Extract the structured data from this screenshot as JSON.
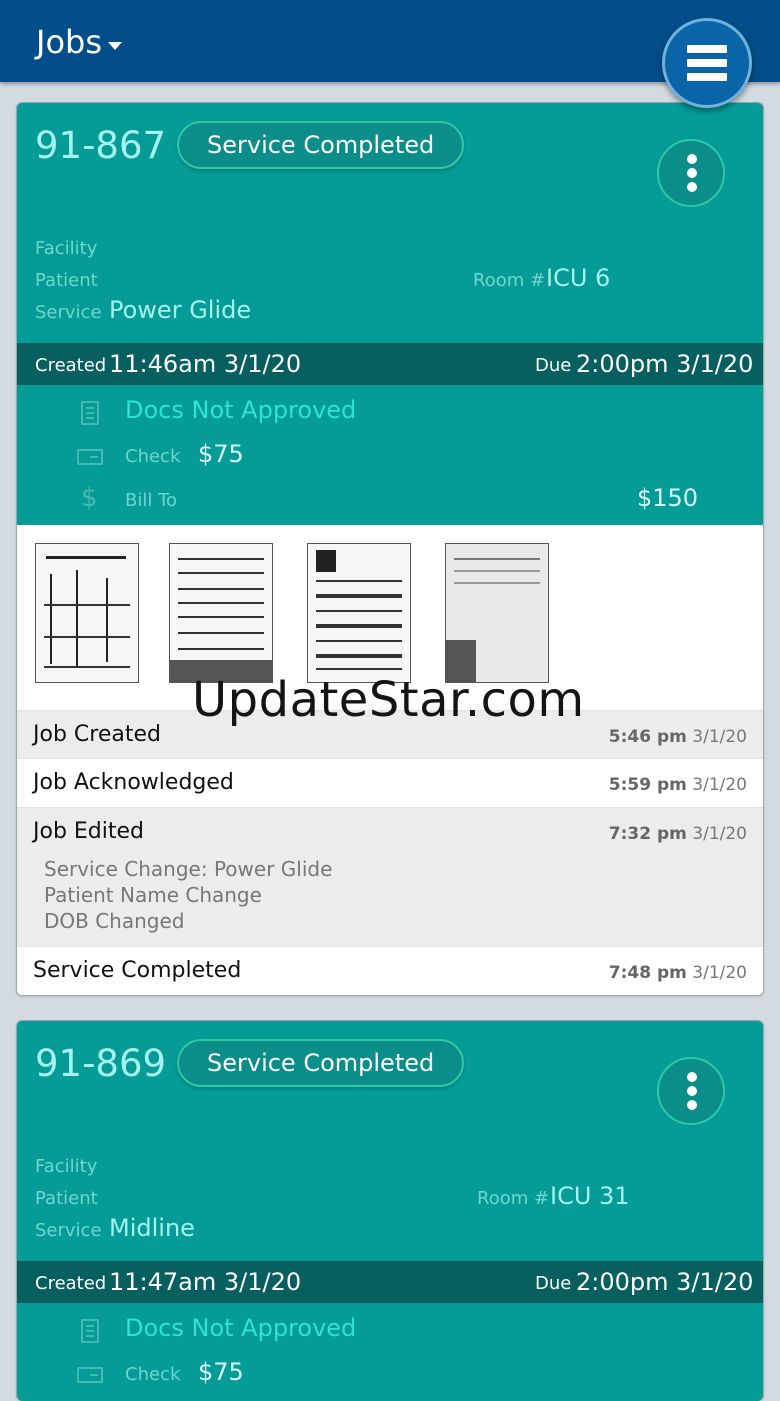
{
  "header": {
    "title": "Jobs"
  },
  "jobs": [
    {
      "id": "91-867",
      "status": "Service Completed",
      "facility_label": "Facility",
      "patient_label": "Patient",
      "service_label": "Service",
      "service_value": "Power Glide",
      "room_label": "Room #",
      "room_value": "ICU 6",
      "created_label": "Created",
      "created_value": "11:46am 3/1/20",
      "due_label": "Due",
      "due_value": "2:00pm 3/1/20",
      "docs_status": "Docs Not Approved",
      "check_label": "Check",
      "check_value": "$75",
      "bill_label": "Bill To",
      "bill_value": "$150",
      "timeline": [
        {
          "event": "Job Created",
          "time": "5:46 pm",
          "date": "3/1/20"
        },
        {
          "event": "Job Acknowledged",
          "time": "5:59 pm",
          "date": "3/1/20"
        },
        {
          "event": "Job Edited",
          "time": "7:32 pm",
          "date": "3/1/20",
          "details": [
            "Service Change: Power Glide",
            "Patient Name Change",
            "DOB Changed"
          ]
        },
        {
          "event": "Service Completed",
          "time": "7:48 pm",
          "date": "3/1/20"
        }
      ]
    },
    {
      "id": "91-869",
      "status": "Service Completed",
      "facility_label": "Facility",
      "patient_label": "Patient",
      "service_label": "Service",
      "service_value": "Midline",
      "room_label": "Room #",
      "room_value": "ICU 31",
      "created_label": "Created",
      "created_value": "11:47am 3/1/20",
      "due_label": "Due",
      "due_value": "2:00pm 3/1/20",
      "docs_status": "Docs Not Approved",
      "check_label": "Check",
      "check_value": "$75"
    }
  ],
  "watermark": "UpdateStar.com",
  "colors": {
    "header": "#034e8a",
    "card": "#059b97",
    "date_bar": "#075f5f",
    "accent_text": "#a6f2ec"
  }
}
